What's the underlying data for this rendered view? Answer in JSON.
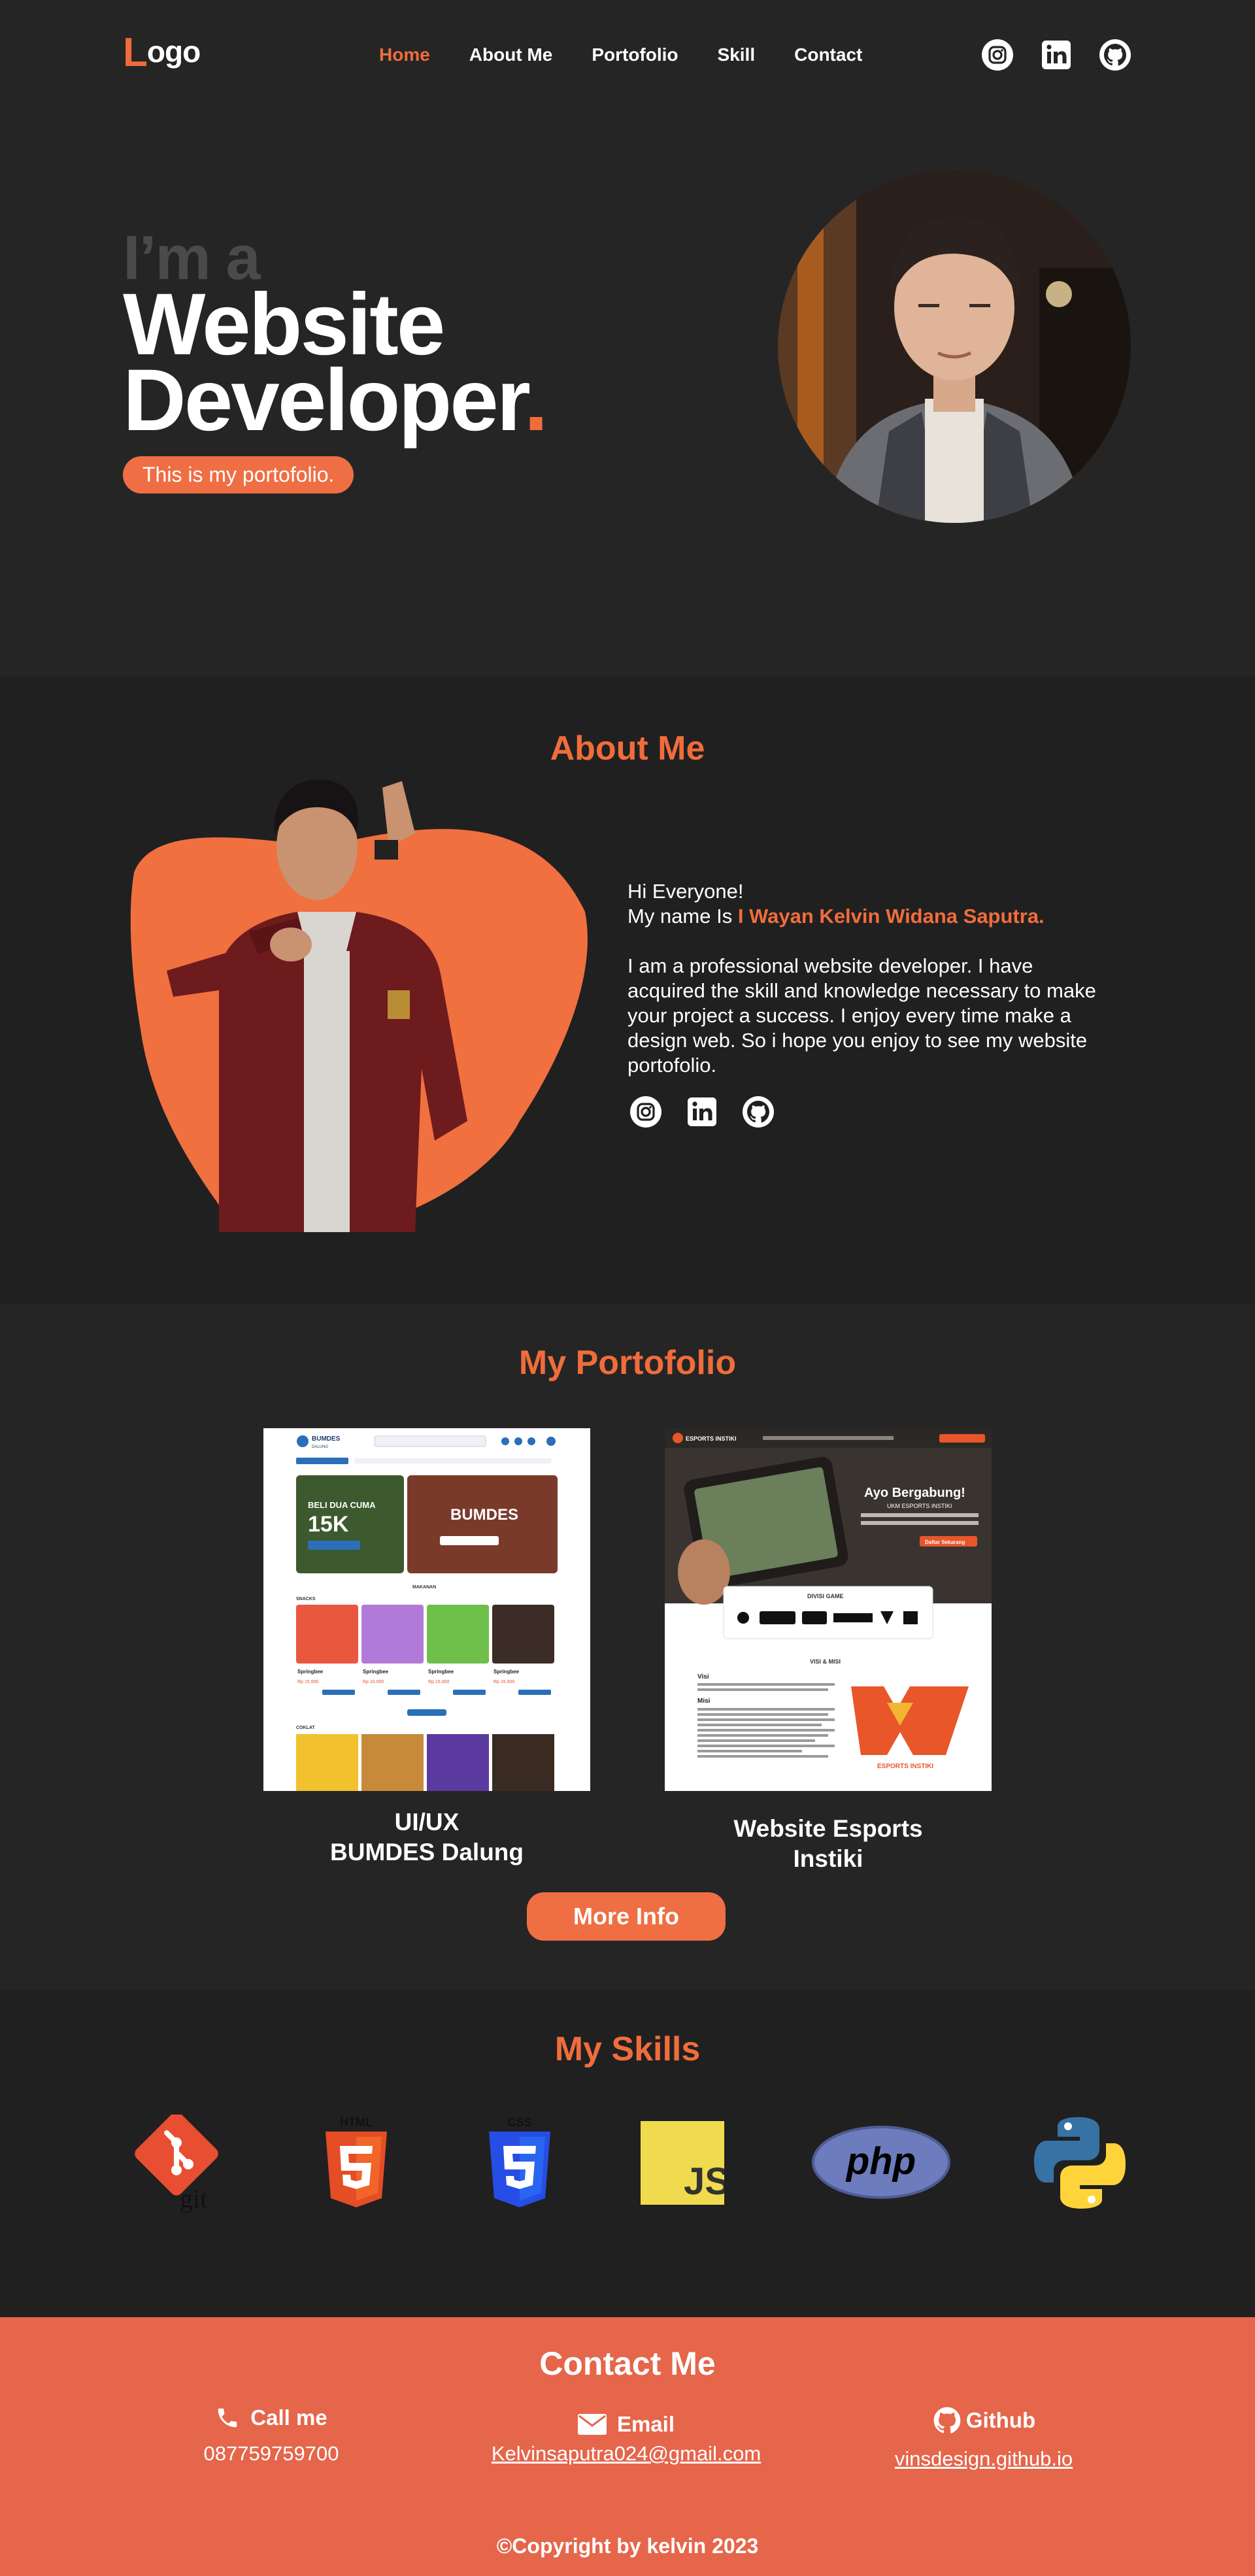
{
  "nav": {
    "logo_first": "L",
    "logo_rest": "ogo",
    "items": [
      {
        "label": "Home",
        "active": true
      },
      {
        "label": "About Me",
        "active": false
      },
      {
        "label": "Portofolio",
        "active": false
      },
      {
        "label": "Skill",
        "active": false
      },
      {
        "label": "Contact",
        "active": false
      }
    ],
    "social": [
      "instagram-icon",
      "linkedin-icon",
      "github-icon"
    ]
  },
  "hero": {
    "intro": "I’m a",
    "line1": "Website",
    "line2": "Developer",
    "dot": ".",
    "tagline": "This is my portofolio."
  },
  "about": {
    "title": "About Me",
    "greeting": "Hi Everyone!",
    "name_prefix": "My name Is ",
    "name": "I Wayan Kelvin Widana Saputra.",
    "bio": "I am a professional website developer. I have acquired the skill and knowledge necessary to make your project a success. I enjoy every time make a design web. So i hope you enjoy to see my website portofolio."
  },
  "portfolio": {
    "title": "My Portofolio",
    "items": [
      {
        "line1": "UI/UX",
        "line2": "BUMDES Dalung",
        "preview": {
          "brand": "BUMDES",
          "brand_sub": "DALUNG",
          "banner_tag": "BELI DUA CUMA",
          "banner_price": "15K",
          "banner_title": "BUMDES",
          "section1": "MAKANAN",
          "section2": "SNACKS",
          "section3": "COKLAT",
          "product": "Springbee",
          "price": "Rp 15.000"
        }
      },
      {
        "line1": "Website Esports",
        "line2": "Instiki",
        "preview": {
          "brand": "ESPORTS INSTIKI",
          "cta": "Ayo Bergabung!",
          "cta_sub": "UKM ESPORTS INSTIKI",
          "button": "Daftar Sekarang",
          "divisi": "DIVISI GAME",
          "visi_misi": "VISI & MISI",
          "visi": "Visi",
          "misi": "Misi",
          "logo_caption": "ESPORTS INSTIKI"
        }
      }
    ],
    "button": "More Info"
  },
  "skills": {
    "title": "My Skills",
    "items": [
      {
        "icon": "git-icon",
        "text": "git"
      },
      {
        "icon": "html5-icon",
        "text": "HTML"
      },
      {
        "icon": "css3-icon",
        "text": "CSS"
      },
      {
        "icon": "javascript-icon",
        "text": "JS"
      },
      {
        "icon": "php-icon",
        "text": "php"
      },
      {
        "icon": "python-icon",
        "text": ""
      }
    ]
  },
  "contact": {
    "title": "Contact Me",
    "call_label": "Call me",
    "phone": "087759759700",
    "email_label": "Email",
    "email": "Kelvinsaputra024@gmail.com",
    "github_label": "Github",
    "github": "vinsdesign.github.io",
    "copyright": "©Copyright by kelvin 2023"
  },
  "colors": {
    "accent": "#f06d3b",
    "background": "#252525",
    "section_alt": "#202020",
    "contact_bg": "#e5664b"
  }
}
